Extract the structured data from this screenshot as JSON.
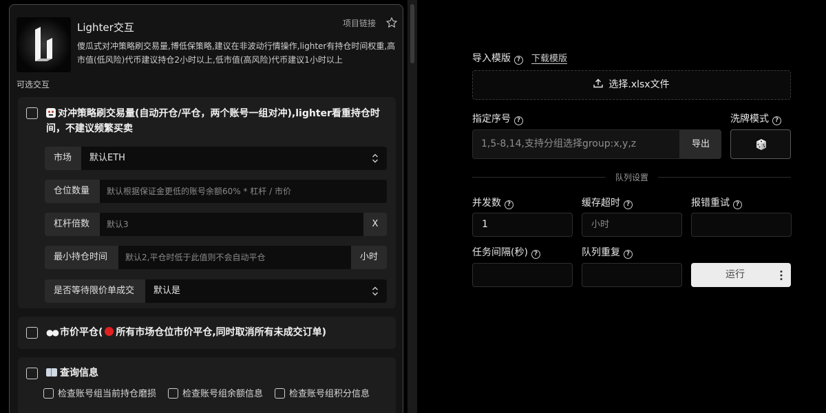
{
  "app": {
    "title": "Lighter交互",
    "project_link": "项目链接",
    "description": "傻瓜式对冲策略刷交易量,博低保策略,建议在非波动行情操作,lighter有持仓时间权重,高市值(低风险)代币建议持仓2小时以上,低市值(高风险)代币建议1小时以上"
  },
  "optional_label": "可选交互",
  "cards": {
    "hedge": {
      "title": "对冲策略刷交易量(自动开仓/平仓，两个账号一组对冲),lighter看重持仓时间，不建议频繁买卖",
      "market": {
        "label": "市场",
        "value": "默认ETH"
      },
      "position_size": {
        "label": "仓位数量",
        "placeholder": "默认根据保证金更低的账号余额60% * 杠杆 / 市价"
      },
      "leverage": {
        "label": "杠杆倍数",
        "placeholder": "默认3",
        "suffix": "X"
      },
      "min_hold": {
        "label": "最小持仓时间",
        "placeholder": "默认2,平仓时低于此值则不会自动平仓",
        "suffix": "小时"
      },
      "wait_limit": {
        "label": "是否等待限价单成交",
        "value": "默认是"
      }
    },
    "market_close": {
      "title_prefix": "市价平仓(",
      "title_suffix": "所有市场仓位市价平仓,同时取消所有未成交订单)"
    },
    "query": {
      "title": "查询信息",
      "checks": [
        "检查账号组当前持仓磨损",
        "检查账号组余额信息",
        "检查账号组积分信息"
      ]
    }
  },
  "right": {
    "import_label": "导入模版",
    "download_link": "下载模版",
    "upload_label": "选择.xlsx文件",
    "seq_label": "指定序号",
    "seq_placeholder": "1,5-8,14,支持分组选择group:x,y,z",
    "export_label": "导出",
    "shuffle_label": "洗牌模式",
    "queue_settings": "队列设置",
    "concurrency_label": "并发数",
    "concurrency_value": "1",
    "cache_timeout_label": "缓存超时",
    "cache_timeout_placeholder": "小时",
    "retry_label": "报错重试",
    "interval_label": "任务间隔(秒)",
    "repeat_label": "队列重复",
    "run_label": "运行"
  },
  "colors": {
    "accent_red": "#e02020",
    "panel_bg": "#141414",
    "card_bg": "#1d1d1d",
    "button_light": "#ececec"
  },
  "icons": [
    "logo-icon",
    "star-icon",
    "help-icon",
    "upload-icon",
    "dice-icon",
    "more-vertical-icon",
    "chevron-updown-icon",
    "red-circle-icon",
    "book-icon",
    "robot-face-icon",
    "eyes-icon"
  ]
}
